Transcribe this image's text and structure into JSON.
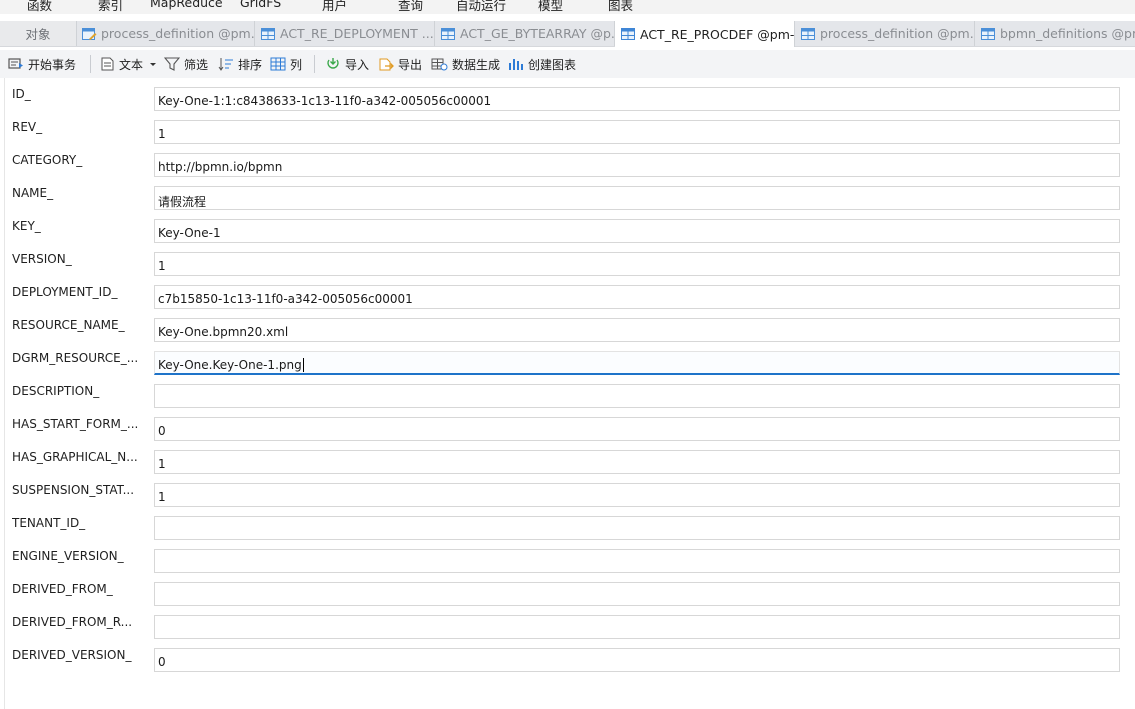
{
  "menu": [
    "函数",
    "索引",
    "MapReduce",
    "GridFS",
    "用户",
    "查询",
    "自动运行",
    "模型",
    "图表"
  ],
  "tabs": {
    "objects_label": "对象",
    "items": [
      {
        "label": "process_definition @pm...",
        "icon": "collection-edit-icon"
      },
      {
        "label": "ACT_RE_DEPLOYMENT ...",
        "icon": "table-icon"
      },
      {
        "label": "ACT_GE_BYTEARRAY @p...",
        "icon": "table-icon"
      },
      {
        "label": "ACT_RE_PROCDEF @pm-...",
        "icon": "table-icon",
        "active": true
      },
      {
        "label": "process_definition @pm...",
        "icon": "table-icon"
      },
      {
        "label": "bpmn_definitions @pm-...",
        "icon": "table-icon"
      }
    ]
  },
  "toolbar": {
    "begin_transaction": "开始事务",
    "text": "文本",
    "filter": "筛选",
    "sort": "排序",
    "columns": "列",
    "import": "导入",
    "export": "导出",
    "data_generation": "数据生成",
    "create_chart": "创建图表"
  },
  "fields": [
    {
      "label": "ID_",
      "value": "Key-One-1:1:c8438633-1c13-11f0-a342-005056c00001"
    },
    {
      "label": "REV_",
      "value": "1"
    },
    {
      "label": "CATEGORY_",
      "value": "http://bpmn.io/bpmn"
    },
    {
      "label": "NAME_",
      "value": "请假流程"
    },
    {
      "label": "KEY_",
      "value": "Key-One-1"
    },
    {
      "label": "VERSION_",
      "value": "1"
    },
    {
      "label": "DEPLOYMENT_ID_",
      "value": "c7b15850-1c13-11f0-a342-005056c00001"
    },
    {
      "label": "RESOURCE_NAME_",
      "value": "Key-One.bpmn20.xml"
    },
    {
      "label": "DGRM_RESOURCE_...",
      "value": "Key-One.Key-One-1.png",
      "focused": true
    },
    {
      "label": "DESCRIPTION_",
      "value": ""
    },
    {
      "label": "HAS_START_FORM_...",
      "value": "0"
    },
    {
      "label": "HAS_GRAPHICAL_N...",
      "value": "1"
    },
    {
      "label": "SUSPENSION_STAT...",
      "value": "1"
    },
    {
      "label": "TENANT_ID_",
      "value": ""
    },
    {
      "label": "ENGINE_VERSION_",
      "value": ""
    },
    {
      "label": "DERIVED_FROM_",
      "value": ""
    },
    {
      "label": "DERIVED_FROM_R...",
      "value": ""
    },
    {
      "label": "DERIVED_VERSION_",
      "value": "0"
    }
  ]
}
